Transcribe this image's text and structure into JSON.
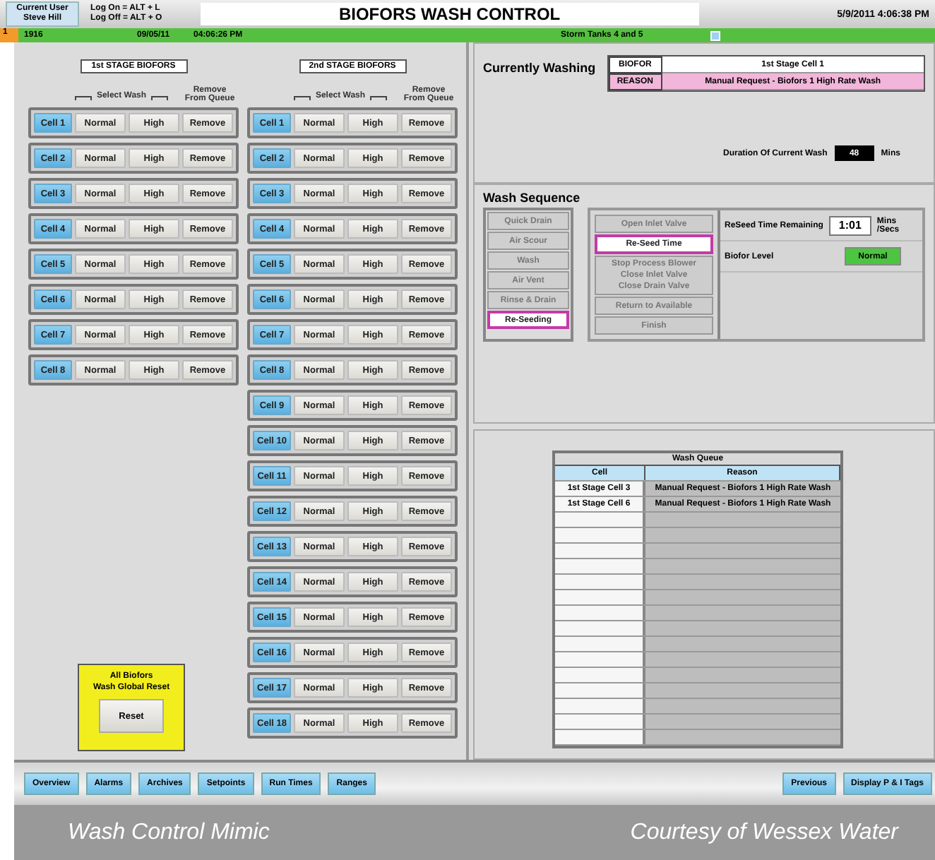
{
  "header": {
    "user_label": "Current User",
    "user_name": "Steve Hill",
    "hints": [
      "Log On = ALT + L",
      "Log Off = ALT + O"
    ],
    "title": "BIOFORS WASH CONTROL",
    "datetime": "5/9/2011 4:06:38 PM"
  },
  "alarm": {
    "number": "1",
    "code": "1916",
    "date": "09/05/11",
    "time": "04:06:26 PM",
    "message": "Storm Tanks 4 and 5"
  },
  "stages": [
    {
      "title": "1st STAGE BIOFORS",
      "select_label": "Select Wash",
      "remove_label": [
        "Remove",
        "From Queue"
      ],
      "cells": [
        {
          "cell": "Cell 1",
          "normal": "Normal",
          "high": "High",
          "remove": "Remove"
        },
        {
          "cell": "Cell 2",
          "normal": "Normal",
          "high": "High",
          "remove": "Remove"
        },
        {
          "cell": "Cell 3",
          "normal": "Normal",
          "high": "High",
          "remove": "Remove"
        },
        {
          "cell": "Cell 4",
          "normal": "Normal",
          "high": "High",
          "remove": "Remove"
        },
        {
          "cell": "Cell 5",
          "normal": "Normal",
          "high": "High",
          "remove": "Remove"
        },
        {
          "cell": "Cell 6",
          "normal": "Normal",
          "high": "High",
          "remove": "Remove"
        },
        {
          "cell": "Cell 7",
          "normal": "Normal",
          "high": "High",
          "remove": "Remove"
        },
        {
          "cell": "Cell 8",
          "normal": "Normal",
          "high": "High",
          "remove": "Remove"
        }
      ]
    },
    {
      "title": "2nd STAGE BIOFORS",
      "select_label": "Select Wash",
      "remove_label": [
        "Remove",
        "From Queue"
      ],
      "cells": [
        {
          "cell": "Cell 1",
          "normal": "Normal",
          "high": "High",
          "remove": "Remove"
        },
        {
          "cell": "Cell 2",
          "normal": "Normal",
          "high": "High",
          "remove": "Remove"
        },
        {
          "cell": "Cell 3",
          "normal": "Normal",
          "high": "High",
          "remove": "Remove"
        },
        {
          "cell": "Cell 4",
          "normal": "Normal",
          "high": "High",
          "remove": "Remove"
        },
        {
          "cell": "Cell 5",
          "normal": "Normal",
          "high": "High",
          "remove": "Remove"
        },
        {
          "cell": "Cell 6",
          "normal": "Normal",
          "high": "High",
          "remove": "Remove"
        },
        {
          "cell": "Cell 7",
          "normal": "Normal",
          "high": "High",
          "remove": "Remove"
        },
        {
          "cell": "Cell 8",
          "normal": "Normal",
          "high": "High",
          "remove": "Remove"
        },
        {
          "cell": "Cell 9",
          "normal": "Normal",
          "high": "High",
          "remove": "Remove"
        },
        {
          "cell": "Cell 10",
          "normal": "Normal",
          "high": "High",
          "remove": "Remove"
        },
        {
          "cell": "Cell 11",
          "normal": "Normal",
          "high": "High",
          "remove": "Remove"
        },
        {
          "cell": "Cell 12",
          "normal": "Normal",
          "high": "High",
          "remove": "Remove"
        },
        {
          "cell": "Cell 13",
          "normal": "Normal",
          "high": "High",
          "remove": "Remove"
        },
        {
          "cell": "Cell 14",
          "normal": "Normal",
          "high": "High",
          "remove": "Remove"
        },
        {
          "cell": "Cell 15",
          "normal": "Normal",
          "high": "High",
          "remove": "Remove"
        },
        {
          "cell": "Cell 16",
          "normal": "Normal",
          "high": "High",
          "remove": "Remove"
        },
        {
          "cell": "Cell 17",
          "normal": "Normal",
          "high": "High",
          "remove": "Remove"
        },
        {
          "cell": "Cell 18",
          "normal": "Normal",
          "high": "High",
          "remove": "Remove"
        }
      ]
    }
  ],
  "reset": {
    "title": [
      "All Biofors",
      "Wash Global Reset"
    ],
    "button": "Reset"
  },
  "currently_washing": {
    "heading": "Currently Washing",
    "rows": [
      {
        "label": "BIOFOR",
        "value": "1st Stage Cell 1",
        "color": "#ffffff"
      },
      {
        "label": "REASON",
        "value": "Manual Request - Biofors 1 High Rate Wash",
        "color": "#f2b6da"
      }
    ],
    "duration_label": "Duration Of Current Wash",
    "duration": "48",
    "duration_unit": "Mins"
  },
  "wash_sequence": {
    "heading": "Wash Sequence",
    "steps": [
      {
        "label": "Quick Drain",
        "active": false
      },
      {
        "label": "Air Scour",
        "active": false
      },
      {
        "label": "Wash",
        "active": false
      },
      {
        "label": "Air Vent",
        "active": false
      },
      {
        "label": "Rinse & Drain",
        "active": false
      },
      {
        "label": "Re-Seeding",
        "active": true
      }
    ],
    "actions": [
      {
        "lines": [
          "Open Inlet Valve"
        ],
        "active": false
      },
      {
        "lines": [
          "Re-Seed Time"
        ],
        "active": true
      },
      {
        "lines": [
          "Stop Process Blower",
          "Close Inlet Valve",
          "Close Drain Valve"
        ],
        "active": false
      },
      {
        "lines": [
          "Return to Available"
        ],
        "active": false
      },
      {
        "lines": [
          "Finish"
        ],
        "active": false
      }
    ],
    "reseed_label": "ReSeed Time Remaining",
    "reseed_value": "1:01",
    "reseed_unit": [
      "Mins",
      "/Secs"
    ],
    "level_label": "Biofor Level",
    "level_value": "Normal"
  },
  "wash_queue": {
    "title": "Wash Queue",
    "columns": [
      "Cell",
      "Reason"
    ],
    "rows": [
      {
        "cell": "1st Stage Cell 3",
        "reason": "Manual Request - Biofors 1 High Rate Wash"
      },
      {
        "cell": "1st Stage Cell 6",
        "reason": "Manual Request - Biofors 1 High Rate Wash"
      }
    ]
  },
  "nav": {
    "left": [
      "Overview",
      "Alarms",
      "Archives",
      "Setpoints",
      "Run Times",
      "Ranges"
    ],
    "right": [
      "Previous",
      "Display P & I Tags"
    ]
  },
  "caption": {
    "left": "Wash Control Mimic",
    "right": "Courtesy of Wessex Water"
  }
}
